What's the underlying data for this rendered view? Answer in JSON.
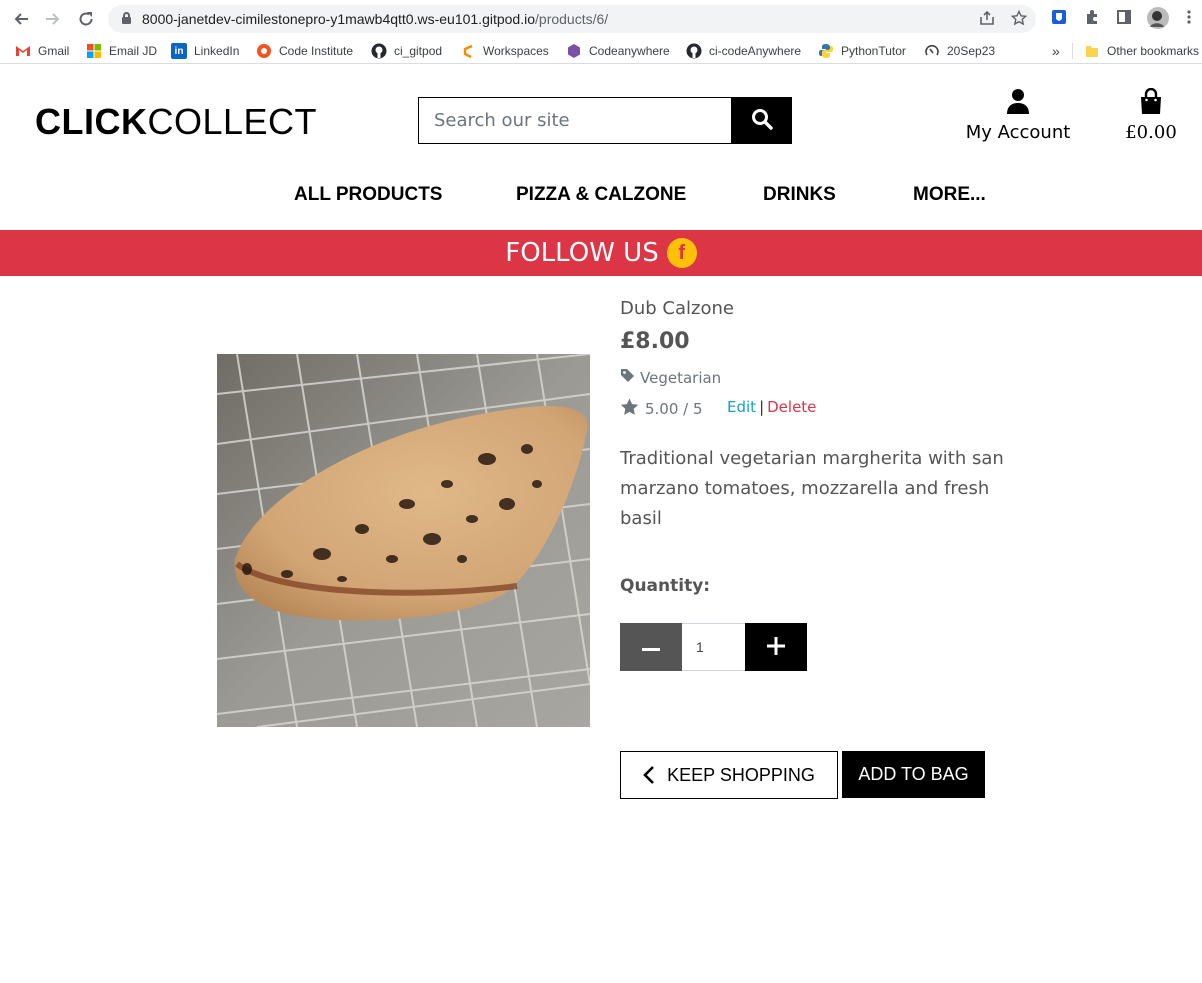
{
  "browser": {
    "url_host": "8000-janetdev-cimilestonepro-y1mawb4qtt0.ws-eu101.gitpod.io",
    "url_path": "/products/6/",
    "bookmarks": [
      {
        "label": "Gmail",
        "icon": "gmail-icon",
        "color": "#ea4335"
      },
      {
        "label": "Email JD",
        "icon": "microsoft-icon",
        "color": "#00a4ef"
      },
      {
        "label": "LinkedIn",
        "icon": "linkedin-icon",
        "color": "#0a66c2"
      },
      {
        "label": "Code Institute",
        "icon": "code-institute-icon",
        "color": "#f4511e"
      },
      {
        "label": "ci_gitpod",
        "icon": "github-icon",
        "color": "#24292e"
      },
      {
        "label": "Workspaces",
        "icon": "gitpod-icon",
        "color": "#ff8a00"
      },
      {
        "label": "Codeanywhere",
        "icon": "codeanywhere-icon",
        "color": "#7b4fa6"
      },
      {
        "label": "ci-codeAnywhere",
        "icon": "github-icon",
        "color": "#24292e"
      },
      {
        "label": "PythonTutor",
        "icon": "python-icon",
        "color": "#3776ab"
      },
      {
        "label": "20Sep23",
        "icon": "loop-icon",
        "color": "#444444"
      }
    ],
    "more_bookmarks": "»",
    "other_bookmarks": "Other bookmarks"
  },
  "header": {
    "logo_bold": "CLICK",
    "logo_light": "COLLECT",
    "search_placeholder": "Search our site",
    "account_label": "My Account",
    "bag_total": "£0.00"
  },
  "nav": {
    "items": [
      "ALL PRODUCTS",
      "PIZZA & CALZONE",
      "DRINKS",
      "MORE..."
    ]
  },
  "banner": {
    "text": "FOLLOW US",
    "icon": "facebook-icon",
    "color": "#dc3545",
    "icon_color": "#ffc107"
  },
  "product": {
    "name": "Dub Calzone",
    "price": "£8.00",
    "category": "Vegetarian",
    "rating": "5.00 / 5",
    "edit_label": "Edit",
    "separator": "|",
    "delete_label": "Delete",
    "description": "Traditional vegetarian margherita with san marzano tomatoes, mozzarella and fresh basil"
  },
  "form": {
    "quantity_label": "Quantity:",
    "quantity_value": "1",
    "keep_shopping_label": "KEEP SHOPPING",
    "add_to_bag_label": "ADD TO BAG"
  }
}
